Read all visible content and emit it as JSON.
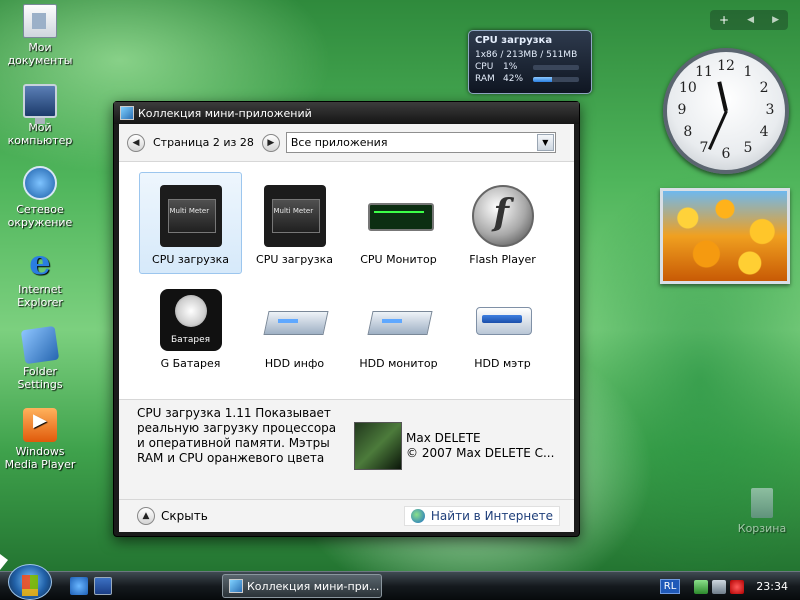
{
  "desktop": {
    "icons": [
      {
        "label": "Мои документы"
      },
      {
        "label": "Мой компьютер"
      },
      {
        "label": "Сетевое окружение"
      },
      {
        "label": "Internet Explorer"
      },
      {
        "label": "Folder Settings"
      },
      {
        "label": "Windows Media Player"
      }
    ],
    "recycle_label": "Корзина"
  },
  "cpu_gadget": {
    "title": "CPU загрузка",
    "summary": "1x86 / 213MB / 511MB",
    "cpu_label": "CPU",
    "cpu_value": "1%",
    "cpu_fraction": 0.01,
    "ram_label": "RAM",
    "ram_value": "42%",
    "ram_fraction": 0.42
  },
  "clock": {
    "numbers": [
      "12",
      "1",
      "2",
      "3",
      "4",
      "5",
      "6",
      "7",
      "8",
      "9",
      "10",
      "11"
    ],
    "hour": 11,
    "minute": 34
  },
  "window": {
    "title": "Коллекция мини-приложений",
    "page_label": "Страница 2 из 28",
    "filter_value": "Все приложения",
    "gadgets": [
      {
        "label": "CPU загрузка",
        "icon": "multimeter-chip-icon"
      },
      {
        "label": "CPU загрузка",
        "icon": "multimeter-chip-icon"
      },
      {
        "label": "CPU Монитор",
        "icon": "cpu-monitor-icon"
      },
      {
        "label": "Flash Player",
        "icon": "flash-player-icon"
      },
      {
        "label": "G Батарея",
        "icon": "battery-icon"
      },
      {
        "label": "HDD инфо",
        "icon": "hard-disk-icon"
      },
      {
        "label": "HDD монитор",
        "icon": "hard-disk-icon"
      },
      {
        "label": "HDD мэтр",
        "icon": "drive-icon"
      }
    ],
    "details": {
      "description": "CPU загрузка 1.11 Показывает реальную загрузку процессора и оперативной памяти. Мэтры RAM и CPU оранжевого цвета",
      "author_name": "Max DELETE",
      "copyright": "© 2007 Max DELETE C..."
    },
    "hide_label": "Скрыть",
    "online_label": "Найти в Интернете"
  },
  "taskbar": {
    "task_label": "Коллекция мини-при...",
    "lang": "RL",
    "time": "23:34"
  }
}
